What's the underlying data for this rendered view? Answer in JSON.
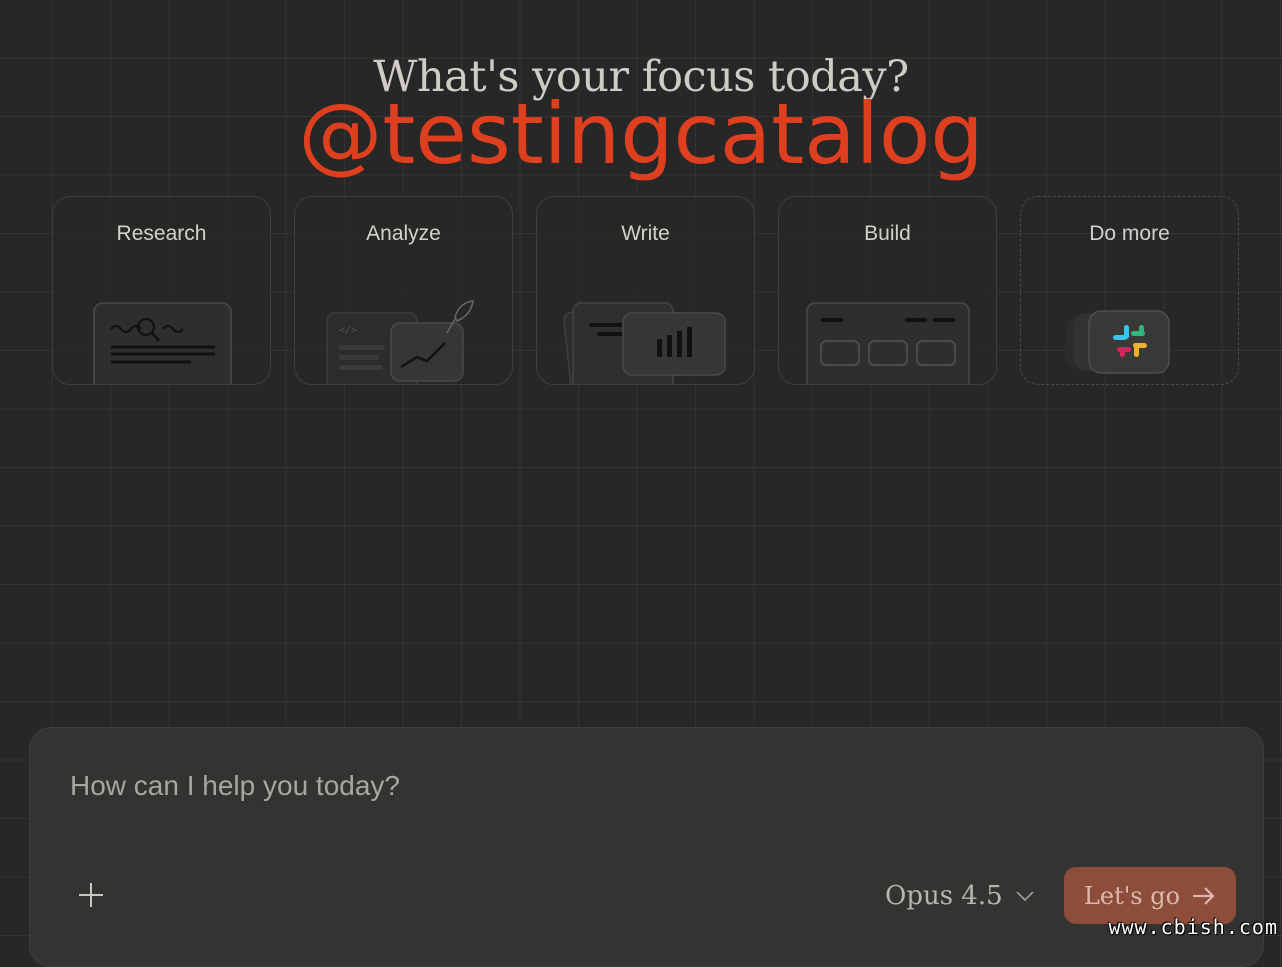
{
  "heading": "What's your focus today?",
  "watermark": "@testingcatalog",
  "cards": [
    {
      "label": "Research",
      "icon": "document-search-icon"
    },
    {
      "label": "Analyze",
      "icon": "code-chart-icon"
    },
    {
      "label": "Write",
      "icon": "bar-chart-card-icon"
    },
    {
      "label": "Build",
      "icon": "app-layout-icon"
    },
    {
      "label": "Do more",
      "icon": "slack-integration-icon"
    }
  ],
  "prompt": {
    "placeholder": "How can I help you today?",
    "add_icon": "plus-icon",
    "model": "Opus 4.5",
    "model_icon": "chevron-down-icon",
    "submit_label": "Let's go",
    "submit_icon": "arrow-right-icon"
  },
  "site_watermark": "www.cbish.com",
  "colors": {
    "background": "#272727",
    "watermark": "#de3f1f",
    "accent_button": "#8c4d3a",
    "slack_blue": "#36c5f0",
    "slack_green": "#2eb67d",
    "slack_red": "#e01e5a",
    "slack_yellow": "#ecb22e"
  }
}
